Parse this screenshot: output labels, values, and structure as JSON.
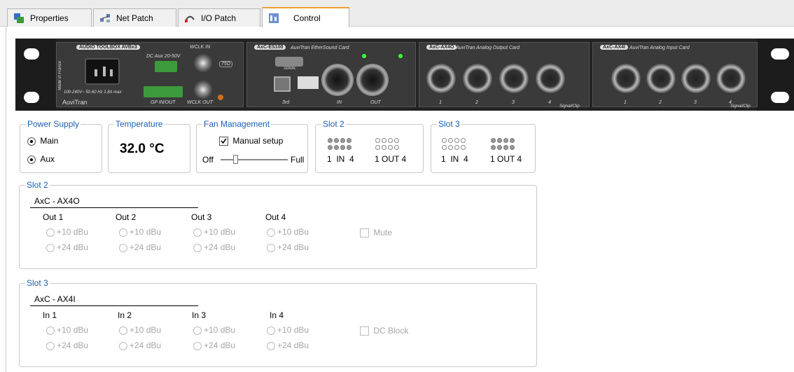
{
  "tabs": [
    {
      "label": "Properties",
      "icon": "properties-icon"
    },
    {
      "label": "Net Patch",
      "icon": "net-patch-icon"
    },
    {
      "label": "I/O Patch",
      "icon": "io-patch-icon"
    },
    {
      "label": "Control",
      "icon": "control-icon"
    }
  ],
  "rack": {
    "psu_label": "AUDIO TOOLBOX AVBx3",
    "dc_aux": "DC Aux 20-50V",
    "wclk_in": "WCLK IN",
    "wclk_out": "WCLK OUT",
    "gp_io": "GP IN/OUT",
    "term": "75Ω",
    "made_in": "Made in France",
    "brand": "AuviTran",
    "mains": "100-240V~ 50-60 Hz 1.8A max",
    "card1_tag": "AxC-ES100",
    "card1_name": "AuviTran EtherSound Card",
    "card1_serial": "SERIAL",
    "card1_port3": "3rd",
    "card1_in": "IN",
    "card1_out": "OUT",
    "card2_tag": "AxC-AX4O",
    "card2_name": "AuviTran Analog Output Card",
    "card3_tag": "AxC-AX4I",
    "card3_name": "AuviTran Analog Input Card",
    "channels": [
      "1",
      "2",
      "3",
      "4"
    ],
    "signal_clip": "Signal/Clip"
  },
  "power": {
    "title": "Power Supply",
    "main": "Main",
    "aux": "Aux"
  },
  "temperature": {
    "title": "Temperature",
    "value": "32.0 °C"
  },
  "fan": {
    "title": "Fan Management",
    "manual": "Manual setup",
    "off": "Off",
    "full": "Full",
    "level": 0.2
  },
  "slot2_status": {
    "title": "Slot 2",
    "in_label": "1  IN  4",
    "out_label": "1 OUT 4"
  },
  "slot3_status": {
    "title": "Slot 3",
    "in_label": "1  IN  4",
    "out_label": "1 OUT 4"
  },
  "slot2": {
    "title": "Slot 2",
    "card": "AxC - AX4O",
    "channels": [
      "Out 1",
      "Out 2",
      "Out 3",
      "Out 4"
    ],
    "opt1": "+10 dBu",
    "opt2": "+24 dBu",
    "extra": "Mute"
  },
  "slot3": {
    "title": "Slot 3",
    "card": "AxC - AX4I",
    "channels": [
      "In 1",
      "In 2",
      "In 3",
      "In 4"
    ],
    "opt1": "+10 dBu",
    "opt2": "+24 dBu",
    "extra": "DC Block"
  },
  "colors": {
    "group_title": "#1a5fb4",
    "tab_accent": "#f0a030",
    "disabled_text": "#a6a6a6",
    "led_green": "#3cff3c"
  }
}
